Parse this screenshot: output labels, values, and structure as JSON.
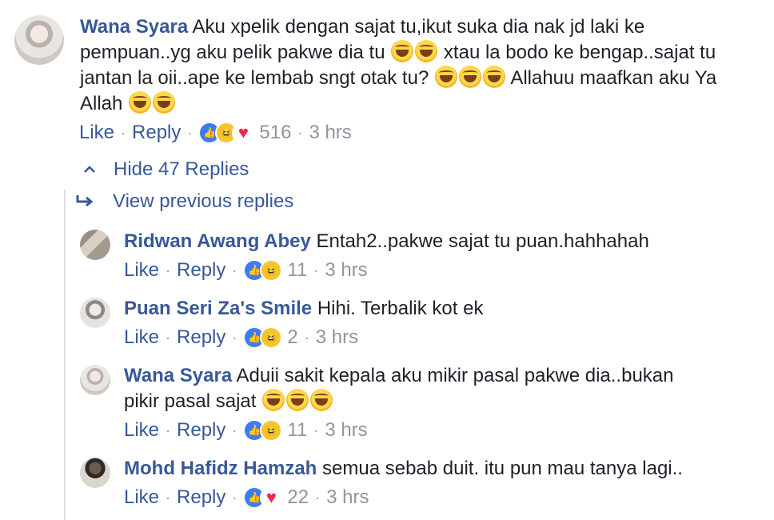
{
  "main_comment": {
    "author": "Wana Syara",
    "text_part1": "Aku xpelik dengan sajat tu,ikut suka dia nak jd laki ke pempuan..yg aku pelik pakwe dia tu",
    "text_part2": "xtau la bodo ke bengap..sajat tu jantan la oii..ape ke lembab sngt otak tu?",
    "text_part3": "Allahuu maafkan aku Ya Allah",
    "like_label": "Like",
    "reply_label": "Reply",
    "reaction_count": "516",
    "time": "3 hrs",
    "reactions": [
      "like-icon",
      "haha-icon",
      "love-icon"
    ]
  },
  "thread": {
    "hide_label": "Hide 47 Replies",
    "view_previous_label": "View previous replies"
  },
  "replies": [
    {
      "author": "Ridwan Awang Abey",
      "text": "Entah2..pakwe sajat tu puan.hahhahah",
      "like_label": "Like",
      "reply_label": "Reply",
      "reaction_count": "11",
      "time": "3 hrs",
      "reactions": [
        "like-icon",
        "haha-icon"
      ]
    },
    {
      "author": "Puan Seri Za's Smile",
      "text": "Hihi. Terbalik kot ek",
      "like_label": "Like",
      "reply_label": "Reply",
      "reaction_count": "2",
      "time": "3 hrs",
      "reactions": [
        "like-icon",
        "haha-icon"
      ]
    },
    {
      "author": "Wana Syara",
      "text": "Aduii sakit kepala aku mikir pasal pakwe dia..bukan pikir pasal sajat",
      "like_label": "Like",
      "reply_label": "Reply",
      "reaction_count": "11",
      "time": "3 hrs",
      "reactions": [
        "like-icon",
        "haha-icon"
      ]
    },
    {
      "author": "Mohd Hafidz Hamzah",
      "text": "semua sebab duit. itu pun mau tanya lagi..",
      "like_label": "Like",
      "reply_label": "Reply",
      "reaction_count": "22",
      "time": "3 hrs",
      "reactions": [
        "like-icon",
        "love-icon"
      ]
    }
  ],
  "colors": {
    "link": "#385898",
    "meta": "#90949c",
    "text": "#1d2129",
    "like": "#3b7cf0",
    "haha": "#f7c42b",
    "love": "#f0284a"
  }
}
